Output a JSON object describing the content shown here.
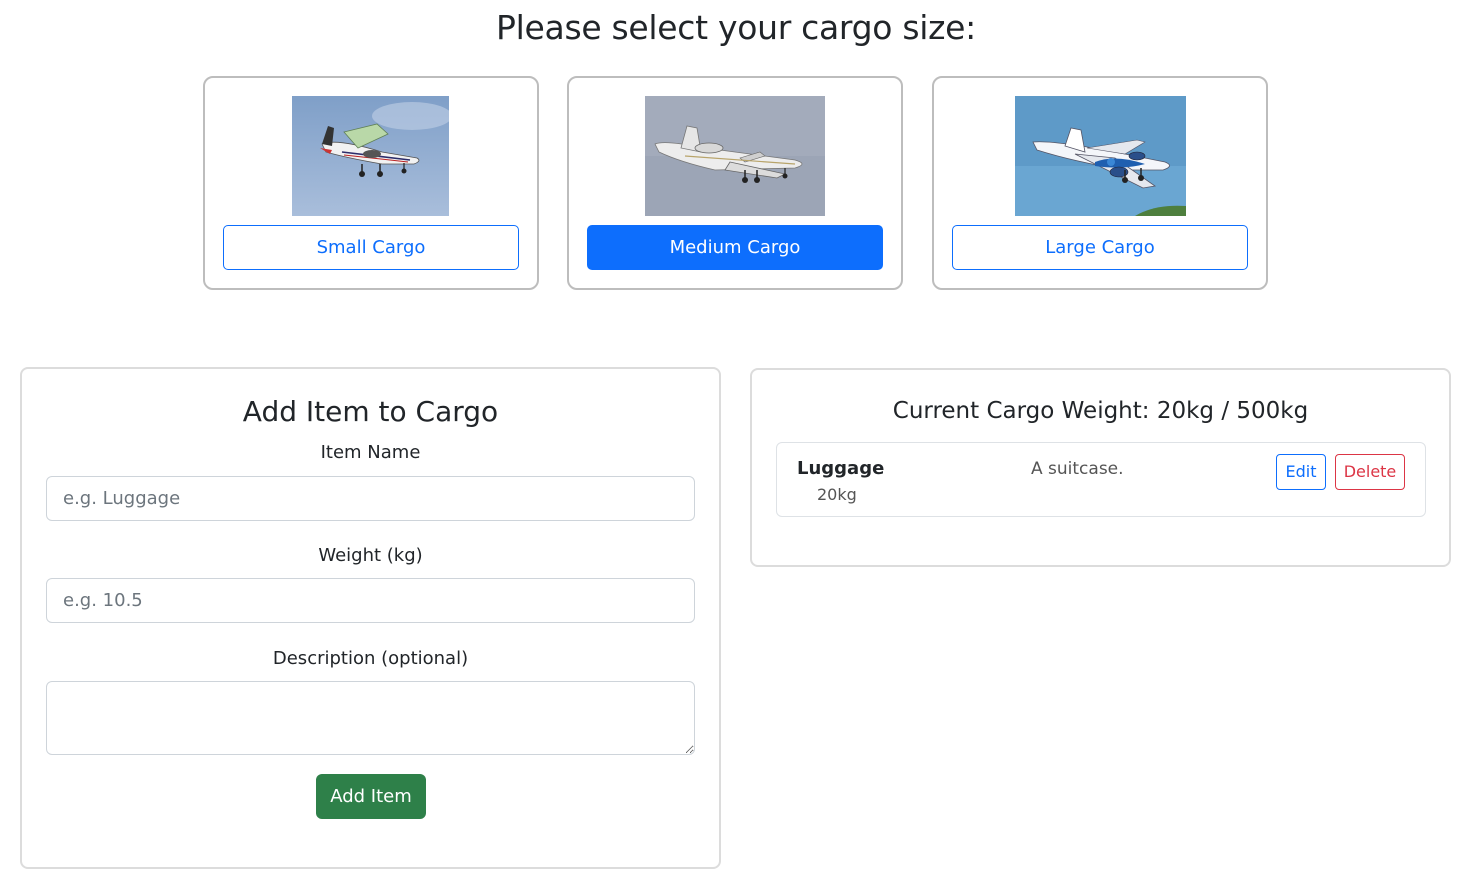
{
  "header": {
    "title": "Please select your cargo size:"
  },
  "cargo_options": [
    {
      "label": "Small Cargo",
      "selected": false,
      "image": "small-twin-prop-plane"
    },
    {
      "label": "Medium Cargo",
      "selected": true,
      "image": "business-jet"
    },
    {
      "label": "Large Cargo",
      "selected": false,
      "image": "airliner"
    }
  ],
  "add_form": {
    "title": "Add Item to Cargo",
    "name_label": "Item Name",
    "name_placeholder": "e.g. Luggage",
    "name_value": "",
    "weight_label": "Weight (kg)",
    "weight_placeholder": "e.g. 10.5",
    "weight_value": "",
    "description_label": "Description (optional)",
    "description_value": "",
    "submit_label": "Add Item"
  },
  "cargo_summary": {
    "title": "Current Cargo Weight: 20kg / 500kg",
    "items": [
      {
        "name": "Luggage",
        "weight": "20kg",
        "description": "A suitcase.",
        "edit_label": "Edit",
        "delete_label": "Delete"
      }
    ]
  },
  "colors": {
    "primary": "#0d6efd",
    "success": "#2e8049",
    "danger": "#dc3545",
    "border": "#bdbdbd"
  }
}
